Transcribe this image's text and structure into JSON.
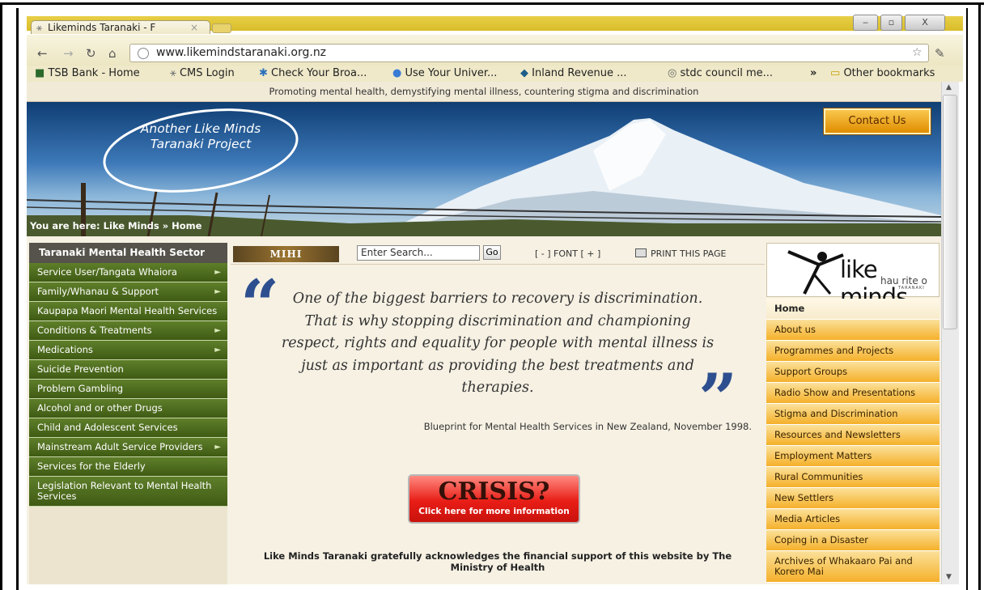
{
  "browser": {
    "tab_title": "Likeminds Taranaki - F",
    "tab_close": "×",
    "url": "www.likemindstaranaki.org.nz",
    "window_buttons": [
      "‒",
      "▫",
      "X"
    ],
    "bookmarks": [
      "TSB Bank - Home",
      "CMS Login",
      "Check Your Broa...",
      "Use Your Univer...",
      "Inland Revenue ...",
      "stdc council me..."
    ],
    "more_bookmarks": "»",
    "other_bookmarks": "Other bookmarks"
  },
  "site": {
    "tagline": "Promoting mental health, demystifying mental illness, countering stigma and discrimination",
    "banner_text": "Another Like Minds Taranaki Project",
    "contact": "Contact Us",
    "breadcrumb": "You are here: Like Minds » Home",
    "left_heading": "Taranaki Mental Health Sector",
    "left_nav": [
      {
        "label": "Service User/Tangata Whaiora",
        "arrow": "►"
      },
      {
        "label": "Family/Whanau & Support",
        "arrow": "►"
      },
      {
        "label": "Kaupapa Maori Mental Health Services",
        "arrow": ""
      },
      {
        "label": "Conditions & Treatments",
        "arrow": "►"
      },
      {
        "label": "Medications",
        "arrow": "►"
      },
      {
        "label": "Suicide Prevention",
        "arrow": ""
      },
      {
        "label": "Problem Gambling",
        "arrow": ""
      },
      {
        "label": "Alcohol and or other Drugs",
        "arrow": ""
      },
      {
        "label": "Child and Adolescent Services",
        "arrow": ""
      },
      {
        "label": "Mainstream Adult Service Providers",
        "arrow": "►"
      },
      {
        "label": "Services for the Elderly",
        "arrow": ""
      },
      {
        "label": "Legislation Relevant to Mental Health Services",
        "arrow": ""
      }
    ],
    "mihi": "MIHI",
    "search_placeholder": "Enter Search...",
    "go": "Go",
    "font_control": "[ - ] FONT [ + ]",
    "print": "PRINT THIS PAGE",
    "open_quote": "“",
    "close_quote": "”",
    "quote": "One of the biggest barriers to recovery is discrimination. That is why stopping discrimination and championing respect, rights and equality for people with mental illness is just as important as providing the best treatments and therapies.",
    "citation": "Blueprint for Mental Health Services in New Zealand, November 1998.",
    "crisis_title": "CRISIS?",
    "crisis_sub": "Click here for more information",
    "acknowledgement": "Like Minds Taranaki gratefully acknowledges the financial support of this website by The Ministry of Health",
    "logo_word": "like minds",
    "logo_sub": "hau rite o",
    "logo_sub2": "TARANAKI",
    "right_nav": [
      "Home",
      "About us",
      "Programmes and Projects",
      "Support Groups",
      "Radio Show and Presentations",
      "Stigma and Discrimination",
      "Resources and Newsletters",
      "Employment Matters",
      "Rural Communities",
      "New Settlers",
      "Media Articles",
      "Coping in a Disaster",
      "Archives of Whakaaro Pai and Korero Mai"
    ]
  },
  "colors": {
    "left_nav": "#4f6d1f",
    "right_nav": "#f5b02a",
    "quote": "#2e4f8f",
    "crisis": "#e81d16"
  }
}
